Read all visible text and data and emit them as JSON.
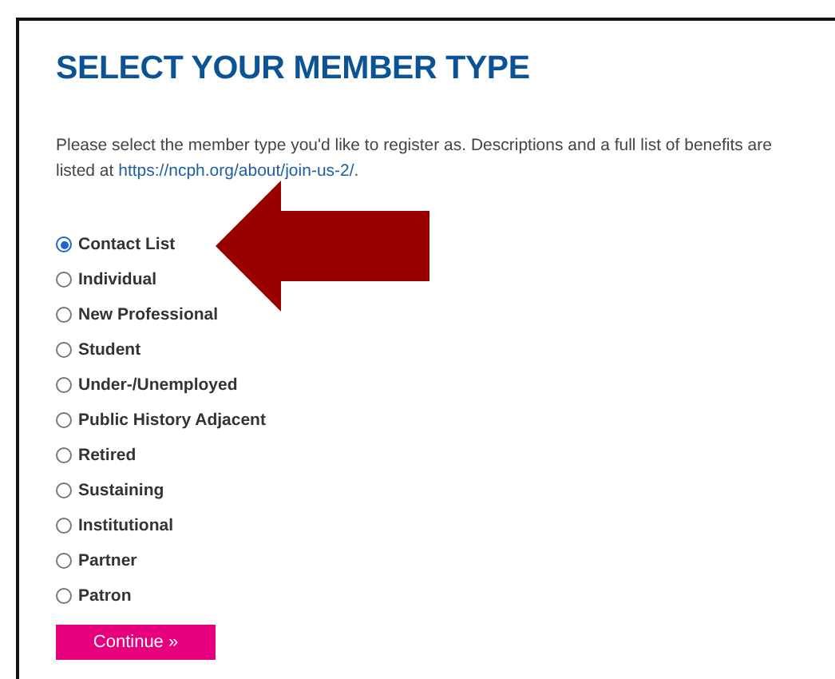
{
  "title": "SELECT YOUR MEMBER TYPE",
  "intro": {
    "text": "Please select the member type you'd like to register as. Descriptions and a full list of benefits are listed at ",
    "link": "https://ncph.org/about/join-us-2/",
    "after": "."
  },
  "member_types": [
    {
      "label": "Contact List",
      "selected": true
    },
    {
      "label": "Individual",
      "selected": false
    },
    {
      "label": "New Professional",
      "selected": false
    },
    {
      "label": "Student",
      "selected": false
    },
    {
      "label": "Under-/Unemployed",
      "selected": false
    },
    {
      "label": "Public History Adjacent",
      "selected": false
    },
    {
      "label": "Retired",
      "selected": false
    },
    {
      "label": "Sustaining",
      "selected": false
    },
    {
      "label": "Institutional",
      "selected": false
    },
    {
      "label": "Partner",
      "selected": false
    },
    {
      "label": "Patron",
      "selected": false
    }
  ],
  "button": "Continue »"
}
